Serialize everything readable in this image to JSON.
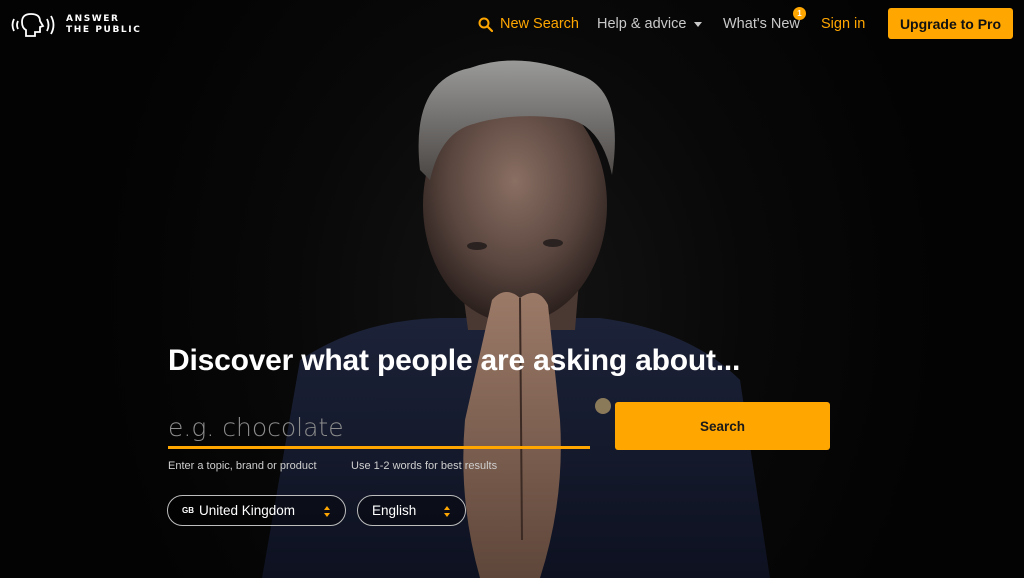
{
  "brand": {
    "logo_line1": "ANSWER",
    "logo_line2": "THE PUBLIC",
    "accent": "#ffa600"
  },
  "nav": {
    "new_search": "New Search",
    "help": "Help & advice",
    "whats_new": "What's New",
    "whats_new_badge": "1",
    "sign_in": "Sign in",
    "upgrade": "Upgrade to Pro"
  },
  "hero": {
    "headline": "Discover what people are asking about...",
    "search_placeholder": "e.g. chocolate",
    "search_button": "Search",
    "hint_topic": "Enter a topic, brand or product",
    "hint_words": "Use 1-2 words for best results",
    "country_code": "GB",
    "country": "United Kingdom",
    "language": "English"
  },
  "icons": {
    "search": "search-icon",
    "logo": "speaking-head-icon",
    "dropdown": "chevron-down-icon",
    "select": "up-down-arrows-icon"
  }
}
